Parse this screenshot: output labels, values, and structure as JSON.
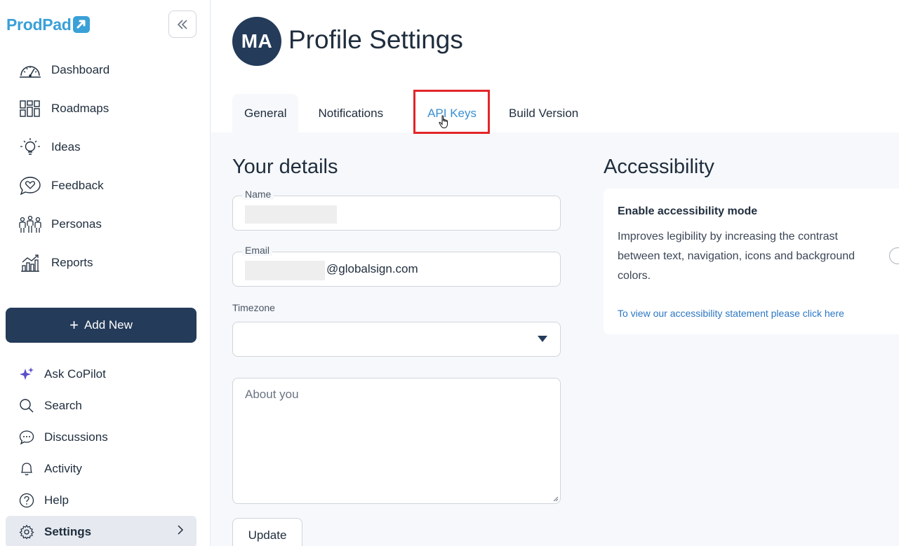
{
  "brand": {
    "name": "ProdPad",
    "accent": "#3aa0d8",
    "navy": "#243b5a",
    "highlight": "#e3242b"
  },
  "sidebar": {
    "main_items": [
      {
        "label": "Dashboard",
        "icon": "gauge-icon"
      },
      {
        "label": "Roadmaps",
        "icon": "grid-icon"
      },
      {
        "label": "Ideas",
        "icon": "lightbulb-icon"
      },
      {
        "label": "Feedback",
        "icon": "heart-chat-icon"
      },
      {
        "label": "Personas",
        "icon": "people-icon"
      },
      {
        "label": "Reports",
        "icon": "chart-icon"
      }
    ],
    "add_new_label": "Add New",
    "secondary_items": [
      {
        "label": "Ask CoPilot",
        "icon": "sparkle-icon"
      },
      {
        "label": "Search",
        "icon": "search-icon"
      },
      {
        "label": "Discussions",
        "icon": "chat-bubble-icon"
      },
      {
        "label": "Activity",
        "icon": "bell-icon"
      },
      {
        "label": "Help",
        "icon": "help-icon"
      },
      {
        "label": "Settings",
        "icon": "gear-icon",
        "active": true
      }
    ]
  },
  "header": {
    "avatar_initials": "MA",
    "title": "Profile Settings",
    "tabs": [
      {
        "label": "General",
        "active": true
      },
      {
        "label": "Notifications",
        "active": false
      },
      {
        "label": "API Keys",
        "active": false,
        "highlighted": true
      },
      {
        "label": "Build Version",
        "active": false
      }
    ]
  },
  "details": {
    "title": "Your details",
    "name_label": "Name",
    "name_value": "",
    "email_label": "Email",
    "email_value": "@globalsign.com",
    "timezone_label": "Timezone",
    "timezone_value": "",
    "about_placeholder": "About you",
    "update_label": "Update"
  },
  "accessibility": {
    "title": "Accessibility",
    "card_title": "Enable accessibility mode",
    "card_description": "Improves legibility by increasing the contrast between text, navigation, icons and background colors.",
    "link_text": "To view our accessibility statement please click here",
    "enabled": false
  }
}
